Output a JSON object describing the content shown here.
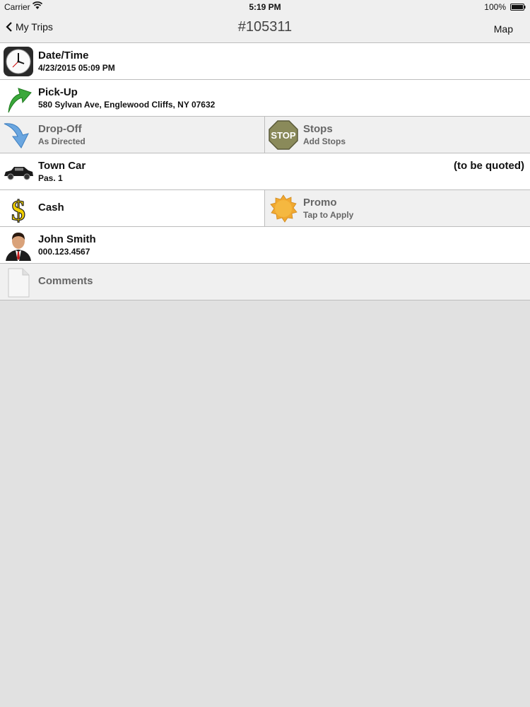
{
  "status": {
    "carrier": "Carrier",
    "time": "5:19 PM",
    "battery": "100%"
  },
  "nav": {
    "back_label": "My Trips",
    "title": "#105311",
    "map_label": "Map"
  },
  "rows": {
    "datetime": {
      "label": "Date/Time",
      "value": "4/23/2015 05:09 PM",
      "icon": "clock-icon"
    },
    "pickup": {
      "label": "Pick-Up",
      "value": "580 Sylvan Ave, Englewood Cliffs, NY 07632",
      "icon": "up-arrow-icon"
    },
    "dropoff": {
      "label": "Drop-Off",
      "value": "As Directed",
      "icon": "down-arrow-icon"
    },
    "stops": {
      "label": "Stops",
      "value": "Add Stops",
      "icon": "stop-sign-icon",
      "icon_text": "STOP"
    },
    "vehicle": {
      "label": "Town Car",
      "value": "Pas. 1",
      "price": "(to be quoted)",
      "icon": "car-icon"
    },
    "payment": {
      "label": "Cash",
      "icon": "dollar-icon",
      "icon_text": "$"
    },
    "promo": {
      "label": "Promo",
      "value": "Tap to Apply",
      "icon": "badge-icon"
    },
    "passenger": {
      "name": "John Smith",
      "phone": "000.123.4567",
      "icon": "person-icon"
    },
    "comments": {
      "label": "Comments",
      "icon": "document-icon"
    }
  }
}
